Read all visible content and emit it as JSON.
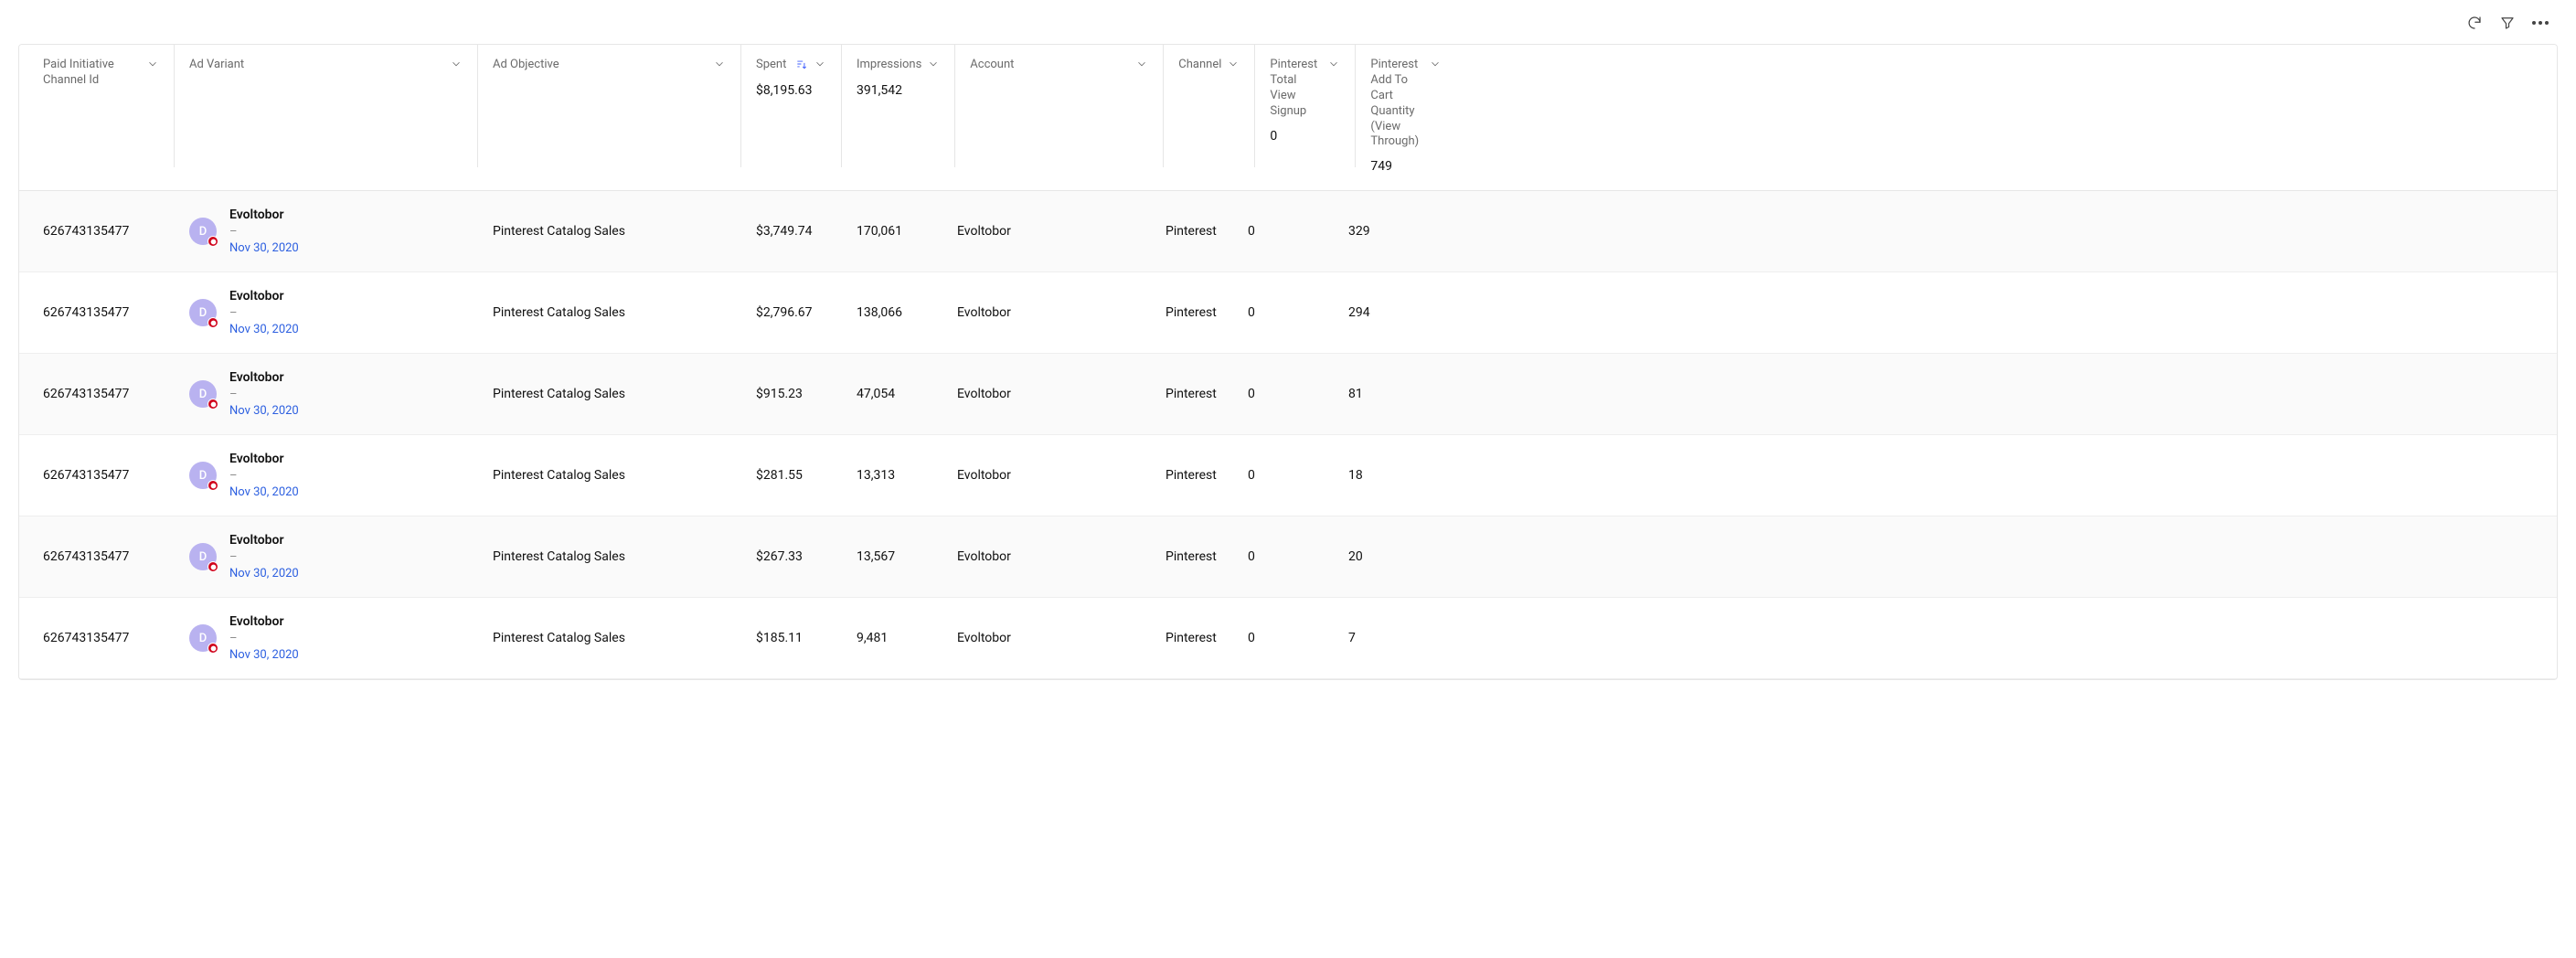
{
  "toolbar": {
    "refresh": "refresh",
    "filter": "filter",
    "more": "more"
  },
  "columns": {
    "id": {
      "label": "Paid Initiative Channel Id"
    },
    "variant": {
      "label": "Ad Variant"
    },
    "objective": {
      "label": "Ad Objective"
    },
    "spent": {
      "label": "Spent",
      "summary": "$8,195.63",
      "sorted": true
    },
    "impr": {
      "label": "Impressions",
      "summary": "391,542"
    },
    "account": {
      "label": "Account"
    },
    "channel": {
      "label": "Channel"
    },
    "signup": {
      "label": "Pinterest Total View Signup",
      "summary": "0"
    },
    "addcart": {
      "label": "Pinterest Add To Cart Quantity (View Through)",
      "summary": "749"
    }
  },
  "variant_shared": {
    "avatar_letter": "D",
    "name": "Evoltobor",
    "sub": "–",
    "date": "Nov 30, 2020"
  },
  "rows": [
    {
      "id": "626743135477",
      "objective": "Pinterest Catalog Sales",
      "spent": "$3,749.74",
      "impr": "170,061",
      "account": "Evoltobor",
      "channel": "Pinterest",
      "signup": "0",
      "addcart": "329"
    },
    {
      "id": "626743135477",
      "objective": "Pinterest Catalog Sales",
      "spent": "$2,796.67",
      "impr": "138,066",
      "account": "Evoltobor",
      "channel": "Pinterest",
      "signup": "0",
      "addcart": "294"
    },
    {
      "id": "626743135477",
      "objective": "Pinterest Catalog Sales",
      "spent": "$915.23",
      "impr": "47,054",
      "account": "Evoltobor",
      "channel": "Pinterest",
      "signup": "0",
      "addcart": "81"
    },
    {
      "id": "626743135477",
      "objective": "Pinterest Catalog Sales",
      "spent": "$281.55",
      "impr": "13,313",
      "account": "Evoltobor",
      "channel": "Pinterest",
      "signup": "0",
      "addcart": "18"
    },
    {
      "id": "626743135477",
      "objective": "Pinterest Catalog Sales",
      "spent": "$267.33",
      "impr": "13,567",
      "account": "Evoltobor",
      "channel": "Pinterest",
      "signup": "0",
      "addcart": "20"
    },
    {
      "id": "626743135477",
      "objective": "Pinterest Catalog Sales",
      "spent": "$185.11",
      "impr": "9,481",
      "account": "Evoltobor",
      "channel": "Pinterest",
      "signup": "0",
      "addcart": "7"
    }
  ]
}
